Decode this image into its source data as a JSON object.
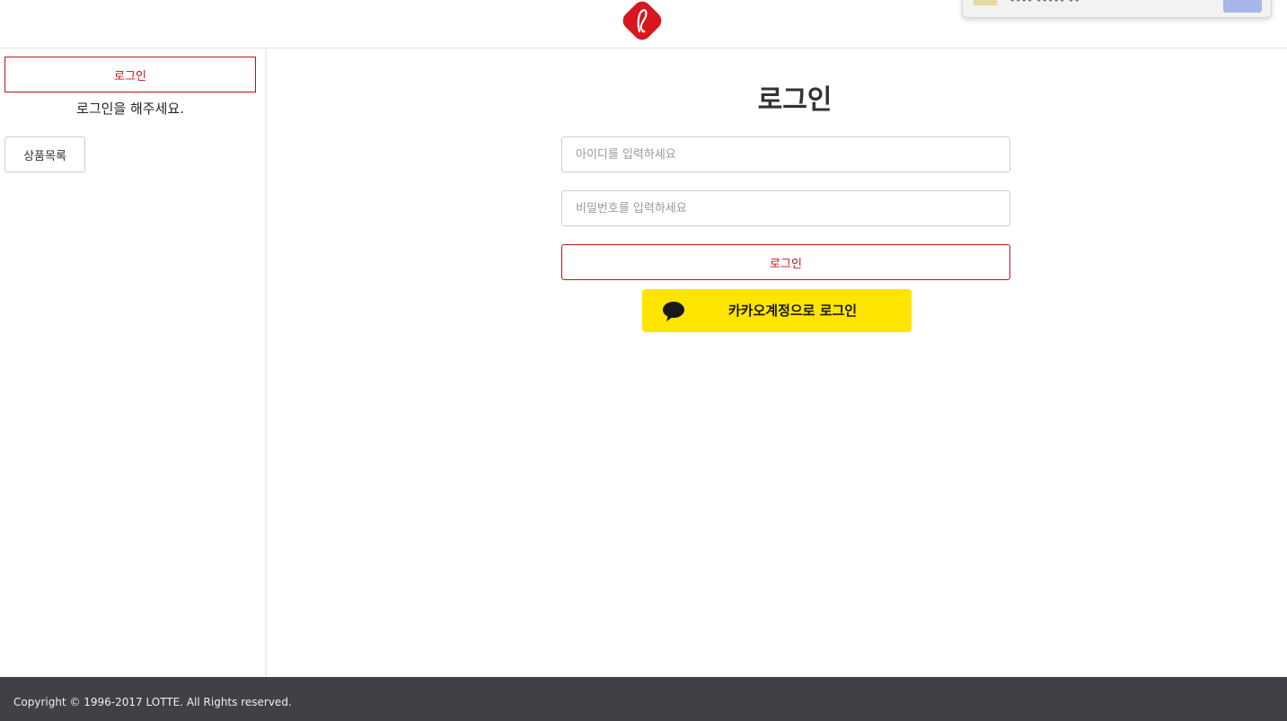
{
  "header": {
    "brand_color": "#d8161e",
    "notification": {
      "text": "•••• ••••• ••"
    }
  },
  "sidebar": {
    "login_label": "로그인",
    "message": "로그인을 해주세요.",
    "product_list_label": "상품목록"
  },
  "main": {
    "title": "로그인",
    "id_placeholder": "아이디를 입력하세요",
    "password_placeholder": "비밀번호를 입력하세요",
    "login_label": "로그인",
    "kakao_label": "카카오계정으로 로그인"
  },
  "footer": {
    "copyright": "Copyright © 1996-2017 LOTTE. All Rights reserved."
  },
  "colors": {
    "accent": "#c0141a",
    "kakao_yellow": "#fee500",
    "footer_bg": "#3f4147"
  }
}
